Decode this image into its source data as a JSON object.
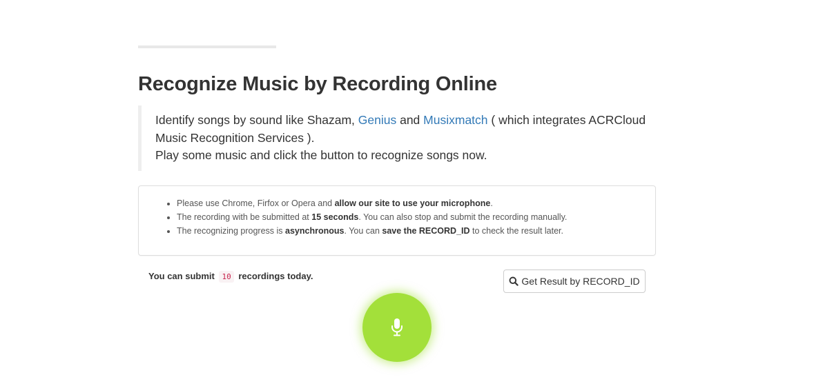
{
  "page": {
    "title": "Recognize Music by Recording Online"
  },
  "intro": {
    "line1_prefix": "Identify songs by sound like Shazam, ",
    "link_genius": "Genius",
    "and_text": " and ",
    "link_musixmatch": "Musixmatch",
    "line1_suffix": " ( which integrates ACRCloud Music Recognition Services ).",
    "line2": "Play some music and click the button to recognize songs now."
  },
  "notice": {
    "items": [
      {
        "before": "Please use Chrome, Firfox or Opera and ",
        "bold": "allow our site to use your microphone",
        "after": "."
      },
      {
        "before": "The recording with be submitted at ",
        "bold": "15 seconds",
        "after": ". You can also stop and submit the recording manually."
      },
      {
        "before": "The recognizing progress is ",
        "bold": "asynchronous",
        "middle": ". You can ",
        "bold2": "save the RECORD_ID",
        "after": " to check the result later."
      }
    ]
  },
  "quota": {
    "prefix": "You can submit",
    "count": "10",
    "suffix": "recordings today."
  },
  "buttons": {
    "get_result_label": "Get Result by RECORD_ID",
    "search_icon": "search-icon",
    "record_icon": "microphone-icon"
  },
  "colors": {
    "link": "#337ab7",
    "record_button": "#a3e03a",
    "code_text": "#c7254e",
    "code_bg": "#f9f2f4"
  }
}
